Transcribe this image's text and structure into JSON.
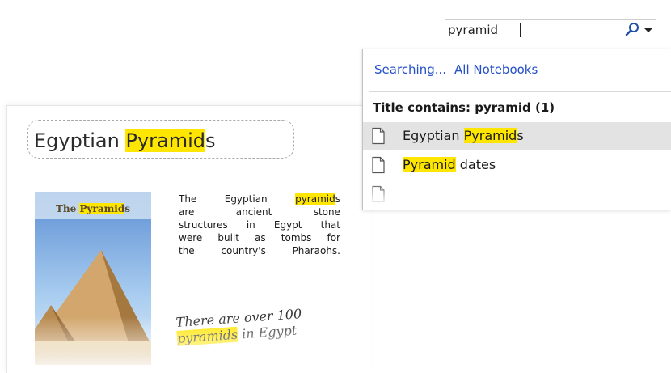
{
  "search": {
    "value": "pyramid",
    "search_button_icon": "magnifier-icon",
    "scope_dropdown_icon": "chevron-down-icon"
  },
  "dropdown": {
    "status": "Searching...",
    "scope_link": "All Notebooks",
    "group_header": "Title contains: pyramid  (1)",
    "results": [
      {
        "pre": "Egyptian ",
        "highlight": "Pyramid",
        "post": "s",
        "icon": "page-icon",
        "selected": true
      },
      {
        "pre": "",
        "highlight": "Pyramid",
        "post": " dates",
        "icon": "page-icon",
        "selected": false
      }
    ]
  },
  "page": {
    "title": {
      "pre": "Egyptian ",
      "highlight": "Pyramid",
      "post": "s"
    },
    "cover_title": {
      "pre": "The ",
      "highlight": "Pyramid",
      "post": "s"
    },
    "paragraph": {
      "line1_pre": "The Egyptian ",
      "line1_highlight": "pyramid",
      "line1_post": "s",
      "line2": "are ancient stone",
      "line3": "structures in Egypt that",
      "line4": "were built as tombs for",
      "line5": "the country's Pharaohs."
    },
    "handwritten": {
      "line1": "There are over 100",
      "line2_highlight": "pyramids",
      "line2_post": " in Egypt"
    }
  },
  "colors": {
    "highlight": "#ffe600",
    "link": "#2450c8",
    "selected_row": "#e3e3e3"
  }
}
